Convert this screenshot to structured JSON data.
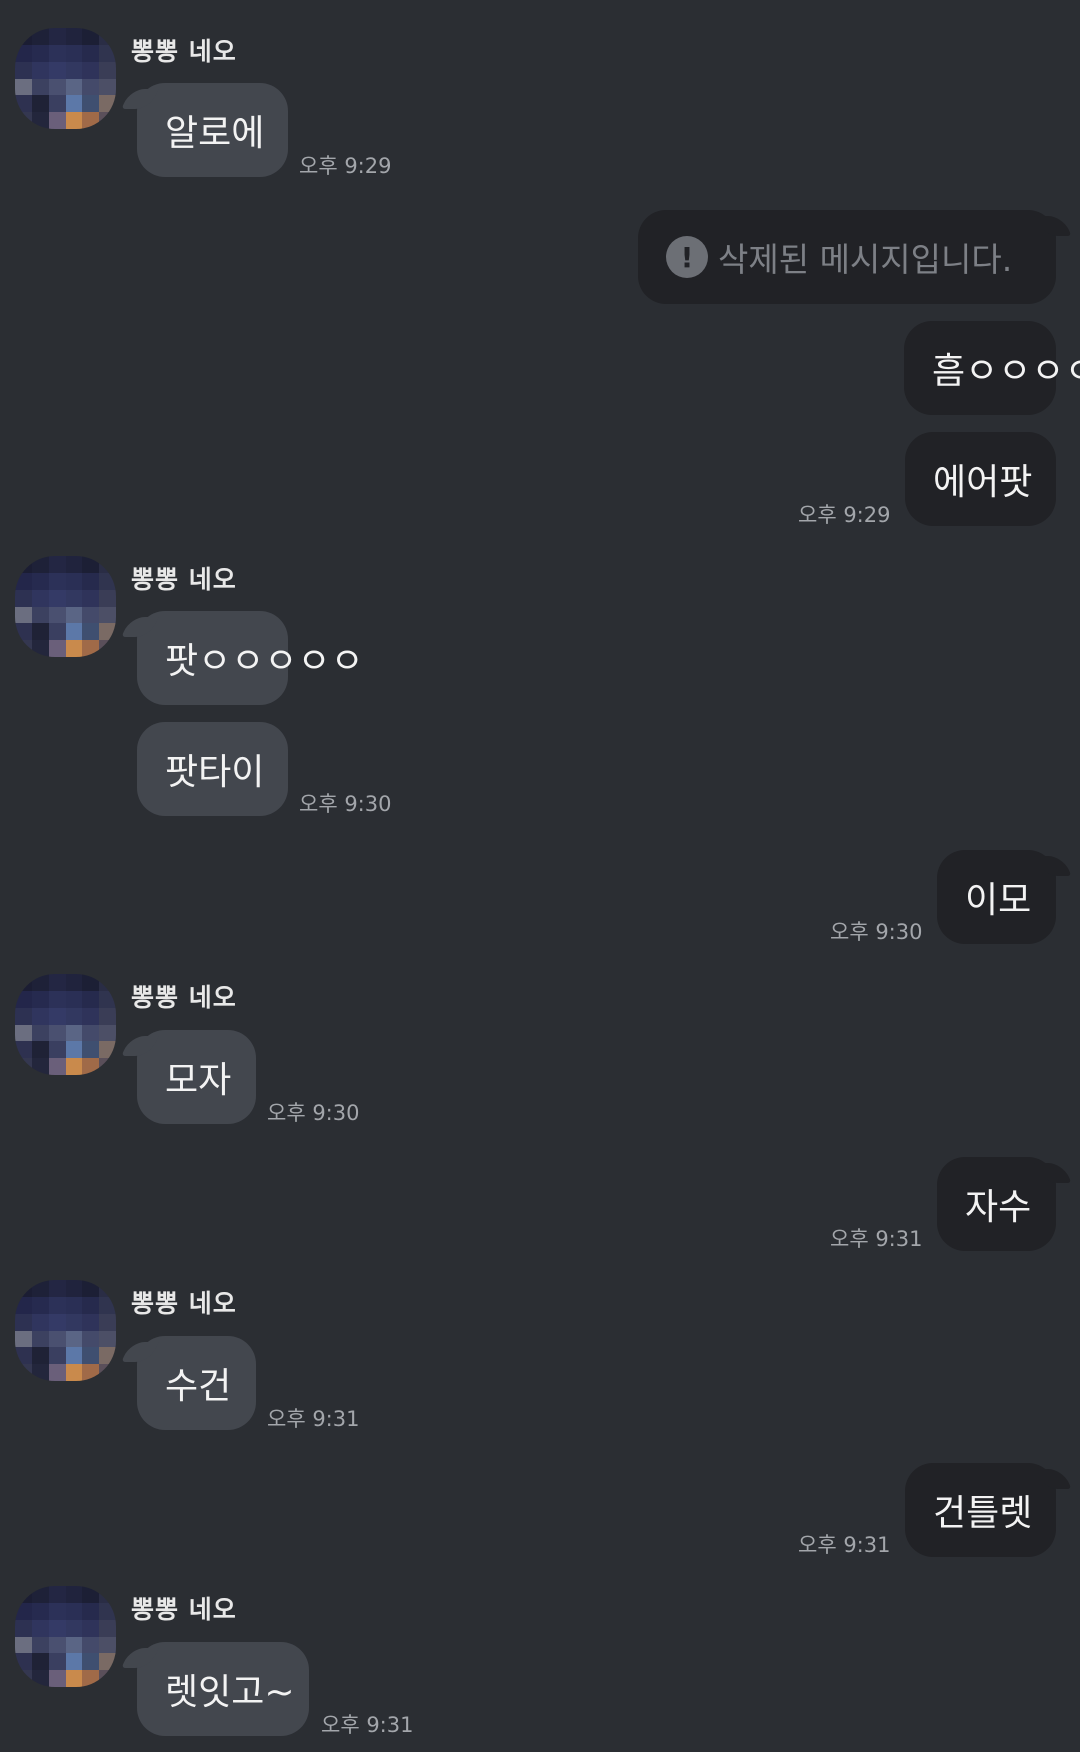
{
  "sender_name": "뽕뽕 네오",
  "deleted_notice": "삭제된 메시지입니다.",
  "alert_glyph": "!",
  "colors": {
    "background": "#2b2e33",
    "incoming_bubble": "#43474e",
    "outgoing_bubble": "#212226",
    "timestamp": "#a3a6ab",
    "deleted_text": "#7d8086"
  },
  "messages": {
    "m1": {
      "text": "알로에",
      "time": "오후 9:29"
    },
    "m2": {
      "time": ""
    },
    "m3": {
      "text": "흠ㅇㅇㅇㅇㅇ"
    },
    "m4": {
      "text": "에어팟",
      "time": "오후 9:29"
    },
    "m5": {
      "text": "팟ㅇㅇㅇㅇㅇ"
    },
    "m6": {
      "text": "팟타이",
      "time": "오후 9:30"
    },
    "m7": {
      "text": "이모",
      "time": "오후 9:30"
    },
    "m8": {
      "text": "모자",
      "time": "오후 9:30"
    },
    "m9": {
      "text": "자수",
      "time": "오후 9:31"
    },
    "m10": {
      "text": "수건",
      "time": "오후 9:31"
    },
    "m11": {
      "text": "건틀렛",
      "time": "오후 9:31"
    },
    "m12": {
      "text": "렛잇고~",
      "time": "오후 9:31"
    }
  }
}
